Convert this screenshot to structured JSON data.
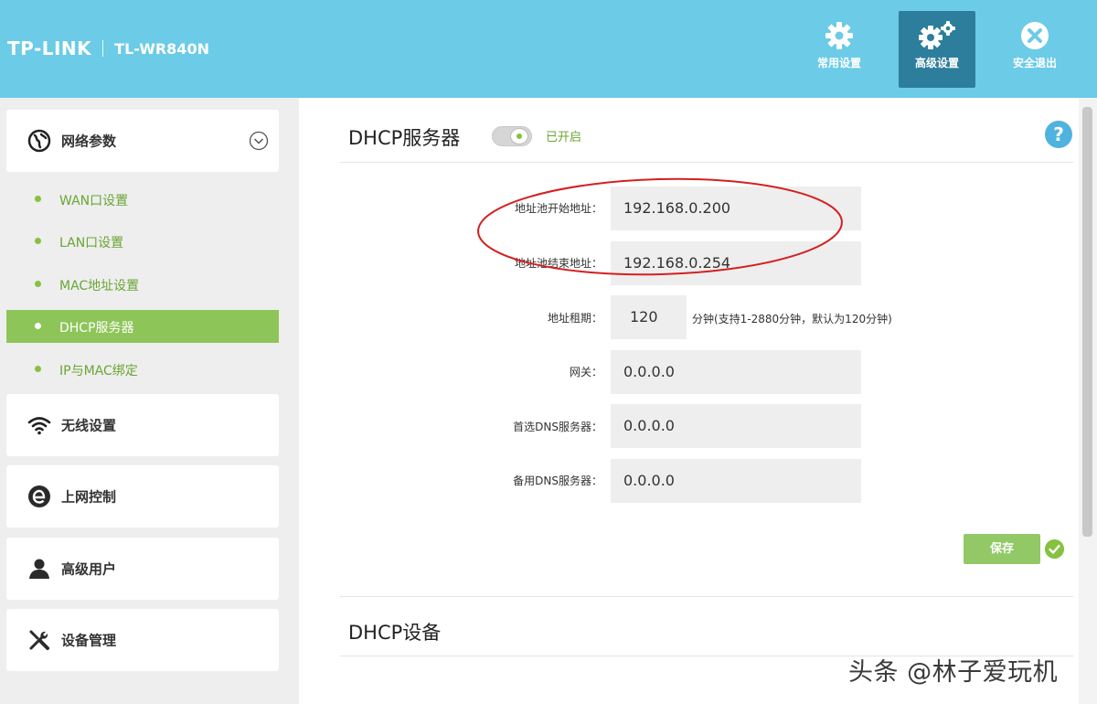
{
  "header": {
    "brand": "TP-LINK",
    "model": "TL-WR840N",
    "buttons": [
      {
        "label": "常用设置",
        "icon": "gear-icon"
      },
      {
        "label": "高级设置",
        "icon": "gears-icon",
        "active": true
      },
      {
        "label": "安全退出",
        "icon": "exit-icon"
      }
    ]
  },
  "sidebar": {
    "network": {
      "label": "网络参数",
      "icon": "globe-icon"
    },
    "sub_items": [
      {
        "label": "WAN口设置"
      },
      {
        "label": "LAN口设置"
      },
      {
        "label": "MAC地址设置"
      },
      {
        "label": "DHCP服务器",
        "active": true
      },
      {
        "label": "IP与MAC绑定"
      }
    ],
    "wireless": {
      "label": "无线设置",
      "icon": "wifi-icon"
    },
    "internet_control": {
      "label": "上网控制",
      "icon": "e-icon"
    },
    "advanced_user": {
      "label": "高级用户",
      "icon": "user-icon"
    },
    "device_mgmt": {
      "label": "设备管理",
      "icon": "tools-icon"
    }
  },
  "dhcp_server": {
    "title": "DHCP服务器",
    "status": "已开启",
    "help": "?",
    "fields": {
      "pool_start": {
        "label": "地址池开始地址：",
        "value": "192.168.0.200"
      },
      "pool_end": {
        "label": "地址池结束地址：",
        "value": "192.168.0.254"
      },
      "lease": {
        "label": "地址租期：",
        "value": "120",
        "hint": "分钟(支持1-2880分钟，默认为120分钟)"
      },
      "gateway": {
        "label": "网关：",
        "value": "0.0.0.0"
      },
      "dns1": {
        "label": "首选DNS服务器：",
        "value": "0.0.0.0"
      },
      "dns2": {
        "label": "备用DNS服务器：",
        "value": "0.0.0.0"
      }
    },
    "save_label": "保存"
  },
  "dhcp_devices": {
    "title": "DHCP设备"
  },
  "watermark": "头条 @林子爱玩机",
  "colors": {
    "header_bg": "#6ccbe6",
    "active_header_btn": "#2d7e9c",
    "accent_green": "#86c13f",
    "active_sidebar": "#8ec559",
    "annotation_red": "#d42020"
  }
}
